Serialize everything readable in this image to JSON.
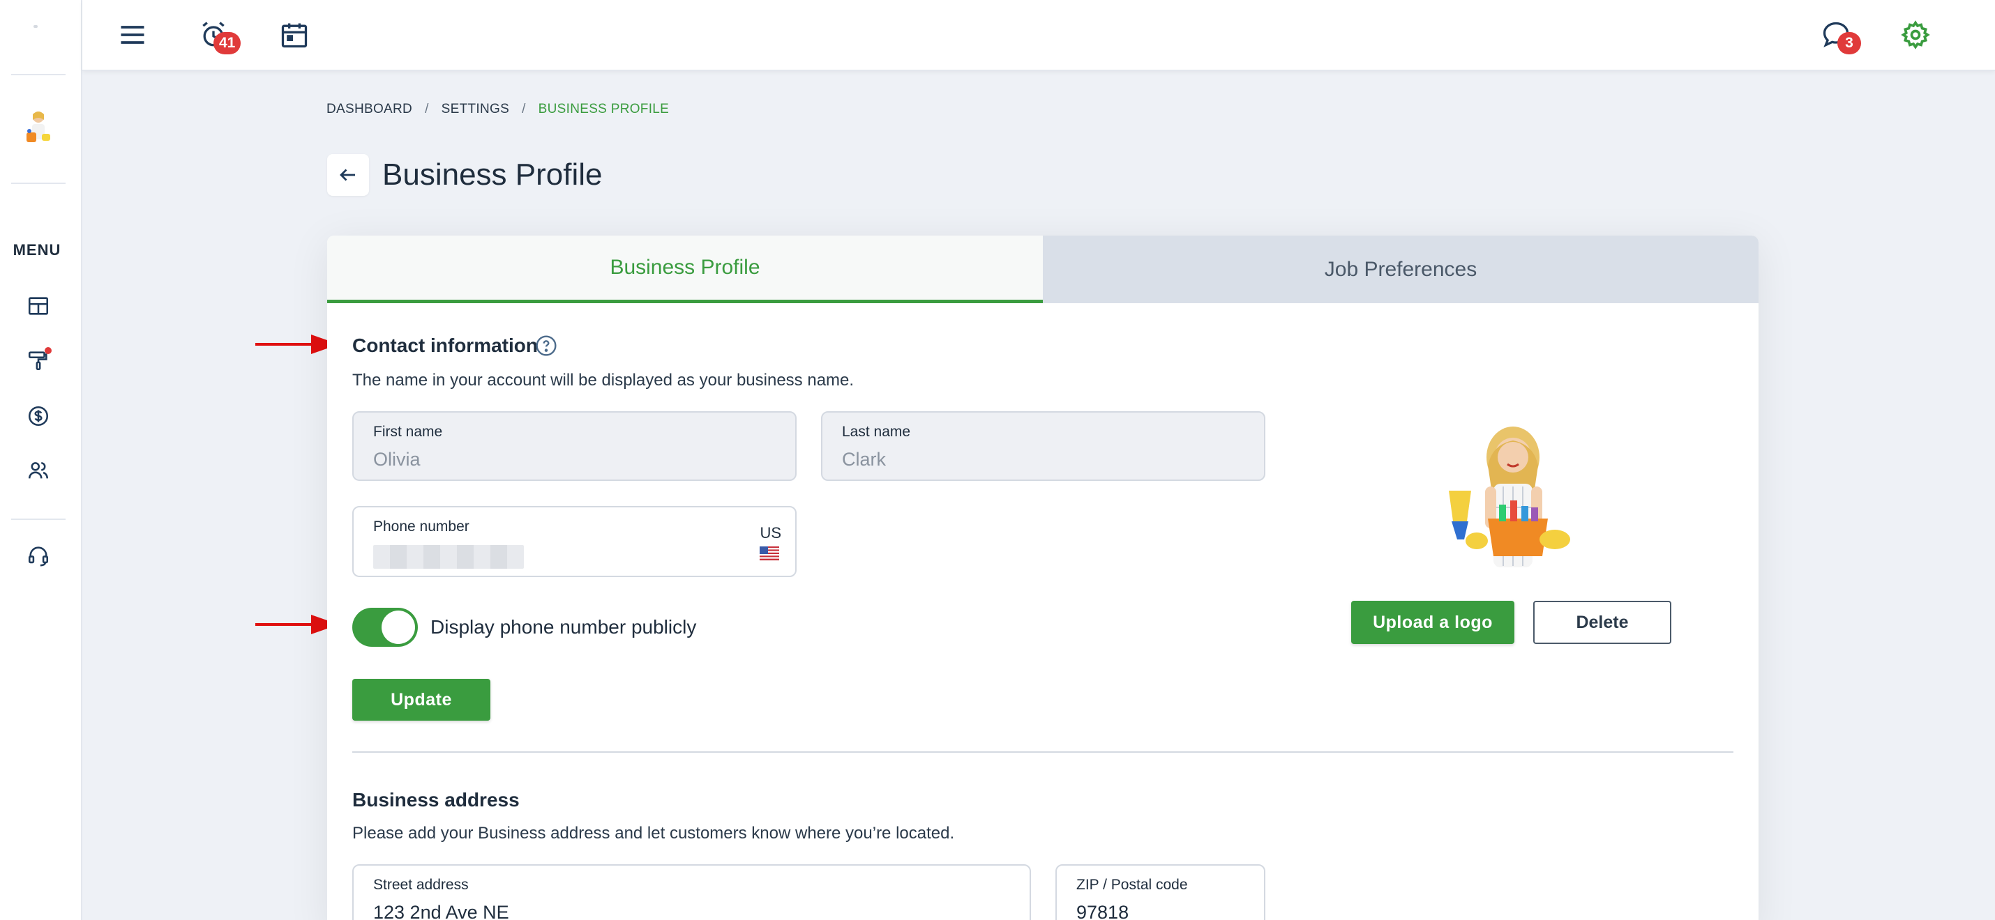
{
  "sidebar": {
    "menu_label": "MENU",
    "items": [
      {
        "name": "dashboard-grid-icon"
      },
      {
        "name": "paint-roller-icon"
      },
      {
        "name": "dollar-icon"
      },
      {
        "name": "users-icon"
      },
      {
        "name": "headset-icon"
      }
    ]
  },
  "topbar": {
    "alarm_badge": "41",
    "messages_badge": "3",
    "accent_color": "#3a9c3f"
  },
  "breadcrumb": {
    "items": [
      "DASHBOARD",
      "SETTINGS",
      "BUSINESS PROFILE"
    ],
    "separator": "/"
  },
  "page": {
    "title": "Business Profile"
  },
  "tabs": [
    {
      "label": "Business Profile",
      "active": true
    },
    {
      "label": "Job Preferences",
      "active": false
    }
  ],
  "contact": {
    "title": "Contact information",
    "description": "The name in your account will be displayed as your business name.",
    "first_name_label": "First name",
    "first_name_value": "Olivia",
    "last_name_label": "Last name",
    "last_name_value": "Clark",
    "phone_label": "Phone number",
    "country_code": "US",
    "display_phone_label": "Display phone number publicly",
    "display_phone_enabled": true,
    "update_button": "Update"
  },
  "logo": {
    "upload_button": "Upload a logo",
    "delete_button": "Delete"
  },
  "address": {
    "title": "Business address",
    "description": "Please add your Business address and let customers know where you’re located.",
    "street_label": "Street address",
    "street_value": "123 2nd Ave NE",
    "zip_label": "ZIP / Postal code",
    "zip_value": "97818"
  }
}
